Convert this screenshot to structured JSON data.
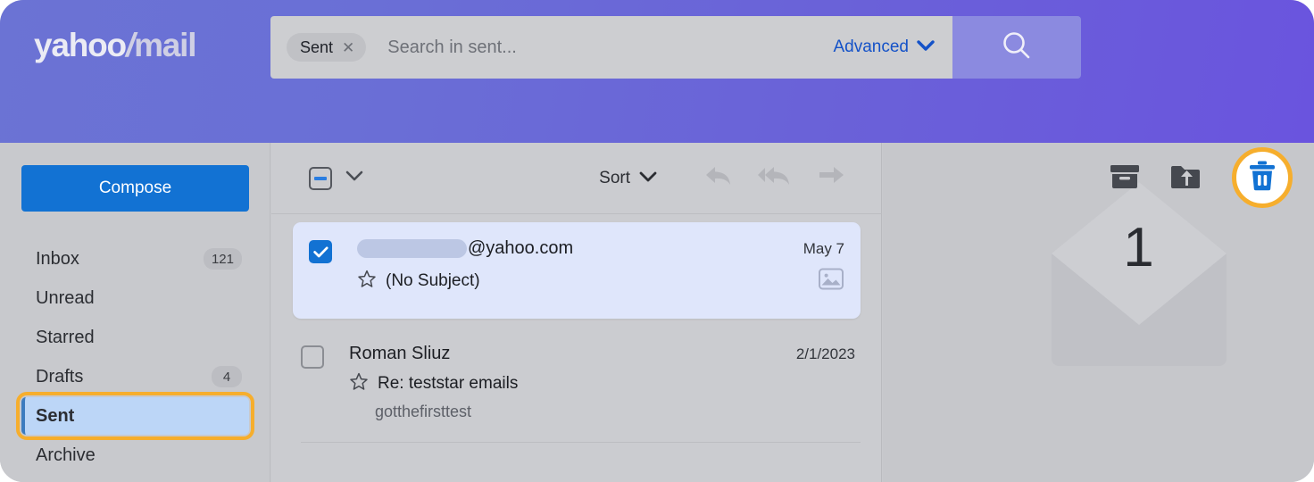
{
  "brand": {
    "name_part1": "yahoo",
    "name_bang": "/",
    "name_part2": "mail",
    "header_gradient_start": "#6b73d4",
    "header_gradient_end": "#6a54de",
    "accent_blue": "#1272d3",
    "highlight_orange": "#f6ae2d"
  },
  "search": {
    "chip_label": "Sent",
    "chip_remove_icon": "close-icon",
    "placeholder": "Search in sent...",
    "advanced_label": "Advanced",
    "advanced_chevron_icon": "chevron-down-icon",
    "search_icon": "search-icon"
  },
  "sidebar": {
    "compose_label": "Compose",
    "items": [
      {
        "label": "Inbox",
        "badge": "121",
        "active": false
      },
      {
        "label": "Unread",
        "badge": "",
        "active": false
      },
      {
        "label": "Starred",
        "badge": "",
        "active": false
      },
      {
        "label": "Drafts",
        "badge": "4",
        "active": false
      },
      {
        "label": "Sent",
        "badge": "",
        "active": true
      },
      {
        "label": "Archive",
        "badge": "",
        "active": false
      }
    ]
  },
  "toolbar": {
    "select_all_state": "indeterminate",
    "select_all_icon": "checkbox-indeterminate-icon",
    "select_all_chevron_icon": "chevron-down-icon",
    "sort_label": "Sort",
    "sort_chevron_icon": "chevron-down-icon",
    "reply_icon": "reply-icon",
    "reply_all_icon": "reply-all-icon",
    "forward_icon": "forward-icon",
    "archive_icon": "archive-box-icon",
    "move_icon": "move-to-folder-icon",
    "delete_icon": "trash-icon",
    "delete_highlighted": true
  },
  "messages": [
    {
      "selected": true,
      "checked": true,
      "sender_redacted": true,
      "sender_suffix": "@yahoo.com",
      "date": "May 7",
      "star_icon": "star-outline-icon",
      "subject": "(No Subject)",
      "preview": "",
      "attachment_icon": "image-thumbnail-icon"
    },
    {
      "selected": false,
      "checked": false,
      "sender_redacted": false,
      "sender_suffix": "Roman Sliuz",
      "date": "2/1/2023",
      "star_icon": "star-outline-icon",
      "subject": "Re: teststar emails",
      "preview": "gotthefirsttest",
      "attachment_icon": ""
    }
  ],
  "reading_pane": {
    "empty_illustration_icon": "envelope-icon",
    "count": "1"
  }
}
